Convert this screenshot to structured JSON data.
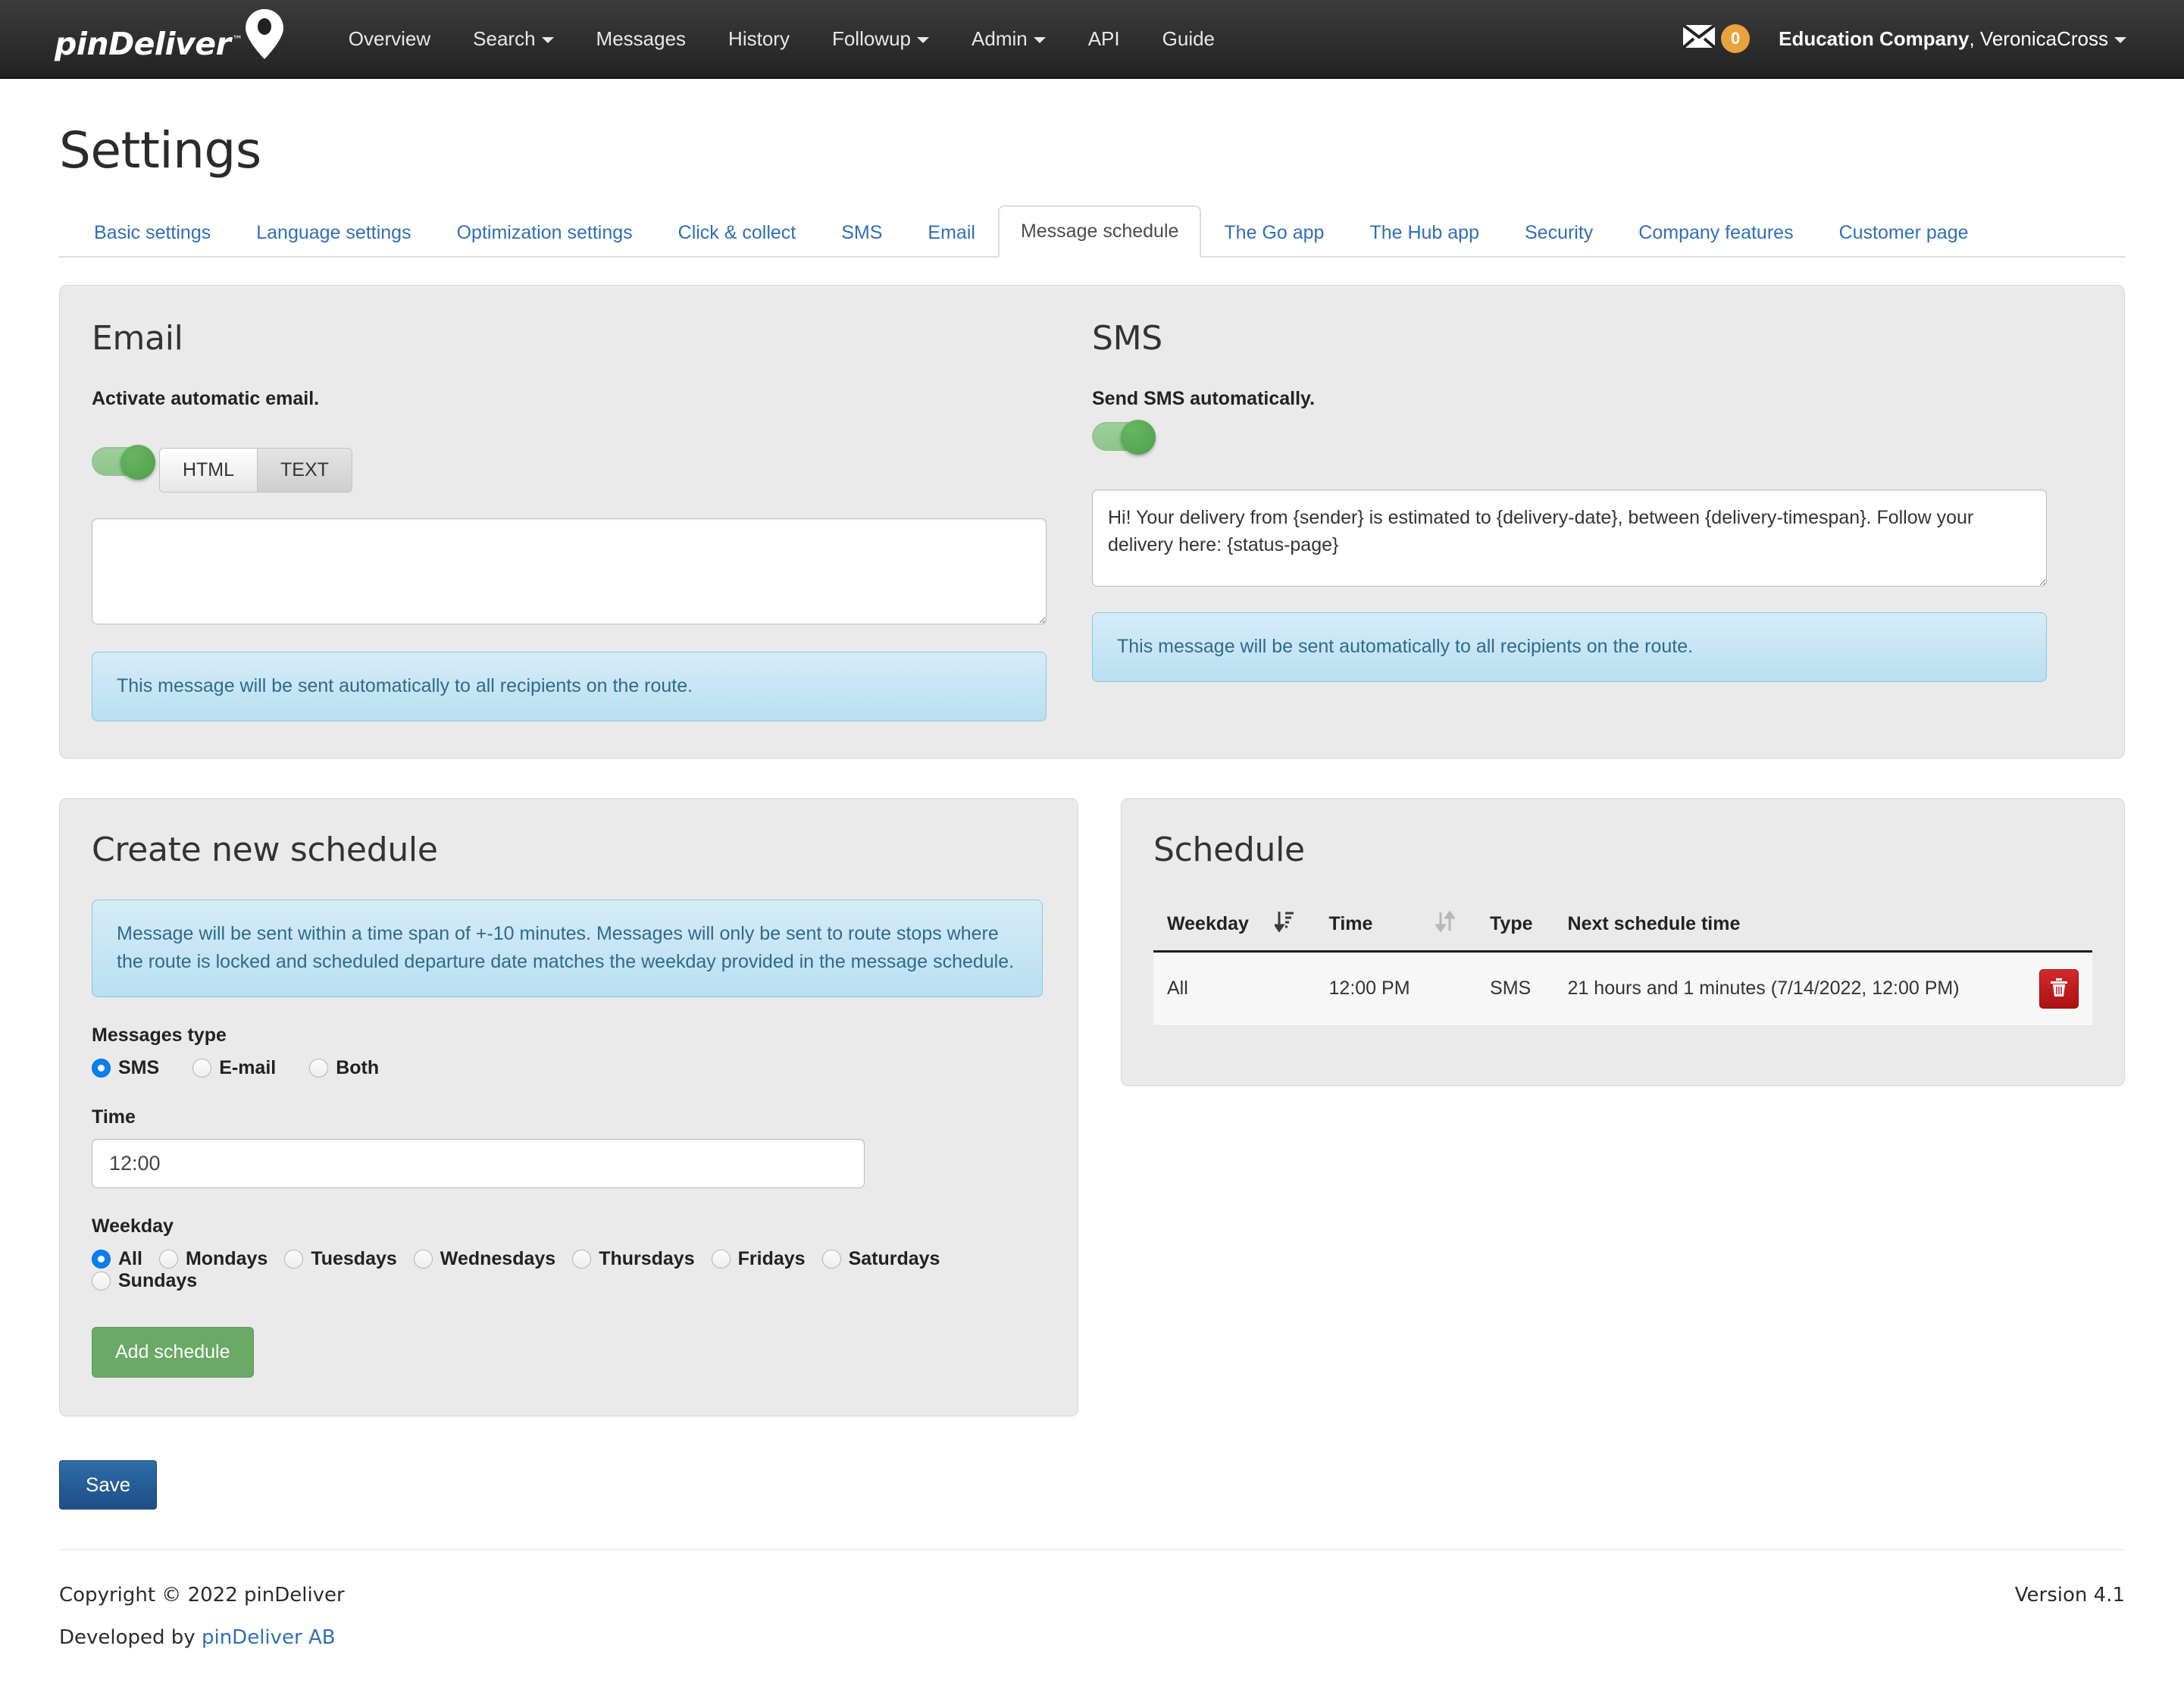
{
  "navbar": {
    "brand": "pinDeliver",
    "brand_tm": "™",
    "brand_icon": "map-pin-icon",
    "links": [
      {
        "label": "Overview",
        "caret": false
      },
      {
        "label": "Search",
        "caret": true
      },
      {
        "label": "Messages",
        "caret": false
      },
      {
        "label": "History",
        "caret": false
      },
      {
        "label": "Followup",
        "caret": true
      },
      {
        "label": "Admin",
        "caret": true
      },
      {
        "label": "API",
        "caret": false
      },
      {
        "label": "Guide",
        "caret": false
      }
    ],
    "mail_icon": "envelope-icon",
    "mail_badge": "0",
    "badge_color": "#e8a33d",
    "company": "Education Company",
    "user_sep": ", ",
    "user": "VeronicaCross"
  },
  "page": {
    "title": "Settings"
  },
  "tabs": [
    {
      "label": "Basic settings",
      "active": false
    },
    {
      "label": "Language settings",
      "active": false
    },
    {
      "label": "Optimization settings",
      "active": false
    },
    {
      "label": "Click & collect",
      "active": false
    },
    {
      "label": "SMS",
      "active": false
    },
    {
      "label": "Email",
      "active": false
    },
    {
      "label": "Message schedule",
      "active": true
    },
    {
      "label": "The Go app",
      "active": false
    },
    {
      "label": "The Hub app",
      "active": false
    },
    {
      "label": "Security",
      "active": false
    },
    {
      "label": "Company features",
      "active": false
    },
    {
      "label": "Customer page",
      "active": false
    }
  ],
  "email": {
    "title": "Email",
    "toggle_label": "Activate automatic email.",
    "toggle_on": true,
    "format_buttons": [
      "HTML",
      "TEXT"
    ],
    "format_selected": "HTML",
    "body": "",
    "alert": "This message will be sent automatically to all recipients on the route."
  },
  "sms": {
    "title": "SMS",
    "toggle_label": "Send SMS automatically.",
    "toggle_on": true,
    "body": "Hi! Your delivery from {sender} is estimated to {delivery-date}, between {delivery-timespan}. Follow your delivery here: {status-page}",
    "alert": "This message will be sent automatically to all recipients on the route."
  },
  "create_schedule": {
    "title": "Create new schedule",
    "alert": "Message will be sent within a time span of +-10 minutes. Messages will only be sent to route stops where the route is locked and scheduled departure date matches the weekday provided in the message schedule.",
    "messages_type_label": "Messages type",
    "messages_type_options": [
      {
        "label": "SMS",
        "selected": true
      },
      {
        "label": "E-mail",
        "selected": false
      },
      {
        "label": "Both",
        "selected": false
      }
    ],
    "time_label": "Time",
    "time_value": "12:00",
    "weekday_label": "Weekday",
    "weekday_options": [
      {
        "label": "All",
        "selected": true
      },
      {
        "label": "Mondays",
        "selected": false
      },
      {
        "label": "Tuesdays",
        "selected": false
      },
      {
        "label": "Wednesdays",
        "selected": false
      },
      {
        "label": "Thursdays",
        "selected": false
      },
      {
        "label": "Fridays",
        "selected": false
      },
      {
        "label": "Saturdays",
        "selected": false
      },
      {
        "label": "Sundays",
        "selected": false
      }
    ],
    "add_button": "Add schedule"
  },
  "schedule": {
    "title": "Schedule",
    "columns": [
      "Weekday",
      "Time",
      "Type",
      "Next schedule time"
    ],
    "sort_icons": [
      "sort-amount-desc-icon",
      "sort-icon"
    ],
    "rows": [
      {
        "weekday": "All",
        "time": "12:00 PM",
        "type": "SMS",
        "next": "21 hours and 1 minutes (7/14/2022, 12:00 PM)",
        "delete_icon": "trash-icon"
      }
    ]
  },
  "actions": {
    "save": "Save"
  },
  "footer": {
    "copyright": "Copyright © 2022 pinDeliver",
    "developed_prefix": "Developed by ",
    "developed_link": "pinDeliver AB",
    "version": "Version 4.1"
  }
}
